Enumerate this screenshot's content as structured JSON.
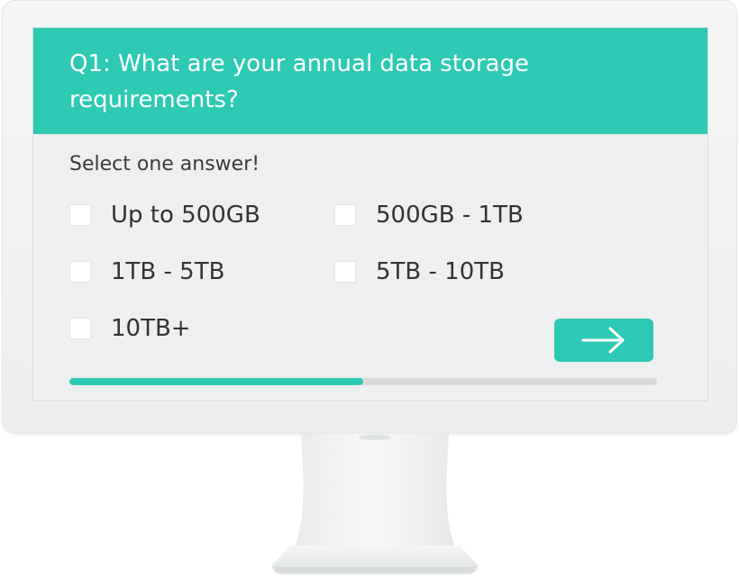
{
  "question": {
    "title": "Q1: What are your annual data storage requirements?"
  },
  "instruction": "Select one answer!",
  "options": [
    {
      "label": "Up to 500GB",
      "checked": false
    },
    {
      "label": "500GB - 1TB",
      "checked": false
    },
    {
      "label": "1TB - 5TB",
      "checked": false
    },
    {
      "label": "5TB - 10TB",
      "checked": false
    },
    {
      "label": "10TB+",
      "checked": false
    }
  ],
  "next_button": {
    "icon": "arrow-right-icon"
  },
  "progress": {
    "fraction": 0.5
  },
  "colors": {
    "accent": "#2ec9b3",
    "track": "#d9dbdb",
    "screen_bg": "#eeeff0",
    "text": "#333333"
  }
}
